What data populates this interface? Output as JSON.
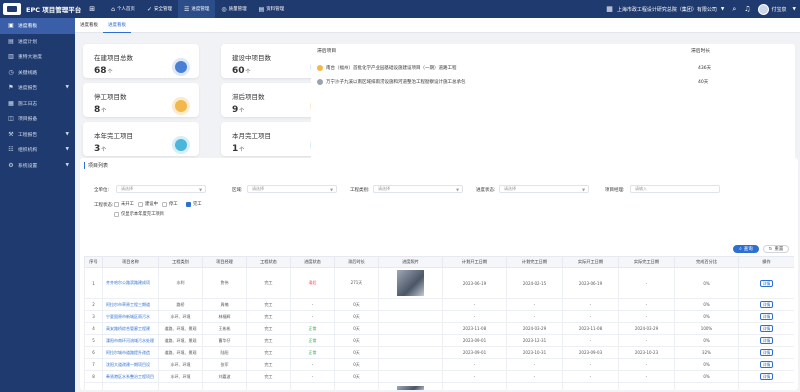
{
  "app": {
    "title": "EPC 项目管理平台"
  },
  "topnav": [
    {
      "icon": "⌂",
      "label": "个人首页",
      "active": false
    },
    {
      "icon": "✓",
      "label": "安全管理",
      "active": false
    },
    {
      "icon": "☰",
      "label": "进度管理",
      "active": true
    },
    {
      "icon": "◎",
      "label": "质量管理",
      "active": false
    },
    {
      "icon": "▤",
      "label": "资料管理",
      "active": false
    }
  ],
  "header": {
    "company": "上海市政工程设计研究总院（集团）有限公司",
    "user": "付宝泉"
  },
  "sidebar": [
    {
      "icon": "▣",
      "label": "进度看板",
      "active": true,
      "expandable": false
    },
    {
      "icon": "▤",
      "label": "进度计划",
      "active": false,
      "expandable": false
    },
    {
      "icon": "▥",
      "label": "重特大进度",
      "active": false,
      "expandable": false
    },
    {
      "icon": "◷",
      "label": "关键线路",
      "active": false,
      "expandable": false
    },
    {
      "icon": "⚑",
      "label": "进度报告",
      "active": false,
      "expandable": true
    },
    {
      "icon": "▦",
      "label": "施工日志",
      "active": false,
      "expandable": false
    },
    {
      "icon": "◫",
      "label": "项目报备",
      "active": false,
      "expandable": false
    },
    {
      "icon": "⚒",
      "label": "工程报告",
      "active": false,
      "expandable": true
    },
    {
      "icon": "☷",
      "label": "组织机构",
      "active": false,
      "expandable": true
    },
    {
      "icon": "⚙",
      "label": "系统设置",
      "active": false,
      "expandable": true
    }
  ],
  "tabs": [
    {
      "label": "进度看板",
      "active": false
    },
    {
      "label": "进度看板",
      "active": true
    }
  ],
  "stats": [
    {
      "title": "在建项目总数",
      "value": "68",
      "unit": "个",
      "color": "#4a7fd6",
      "bg": "#dde8fa"
    },
    {
      "title": "建设中项目数",
      "value": "60",
      "unit": "个",
      "color": "#4a7fd6",
      "bg": "#dde8fa"
    },
    {
      "title": "停工项目数",
      "value": "8",
      "unit": "个",
      "color": "#f2b84b",
      "bg": "#fbeacb"
    },
    {
      "title": "滞后项目数",
      "value": "9",
      "unit": "个",
      "color": "#f2b84b",
      "bg": "#fbeacb"
    },
    {
      "title": "本年完工项目",
      "value": "3",
      "unit": "个",
      "color": "#4ab6d9",
      "bg": "#d6eef7"
    },
    {
      "title": "本月完工项目",
      "value": "1",
      "unit": "个",
      "color": "#4ab6d9",
      "bg": "#d6eef7"
    }
  ],
  "delay": {
    "col_project": "滞后项目",
    "col_duration": "滞后时长",
    "rows": [
      {
        "name": "南台（福州）首批化学产业园基础设施建设项目（一期）道路工程",
        "duration": "436天",
        "color": "#f2b84b"
      },
      {
        "name": "万宁沙子九溪以南区域排雨涝设施和河道整治工程勘察设计施工总承包",
        "duration": "40天",
        "color": "#9aa4b1"
      }
    ]
  },
  "list": {
    "title": "项目列表",
    "filters": {
      "company_label": "全单位:",
      "company_ph": "请选择",
      "region_label": "区域:",
      "region_ph": "请选择",
      "type_label": "工程类别:",
      "type_ph": "请选择",
      "progress_label": "进度状态:",
      "progress_ph": "请选择",
      "manager_label": "项目经理:",
      "manager_ph": "请输入"
    },
    "status_label": "工程状态:",
    "statuses": [
      {
        "label": "未开工",
        "checked": false
      },
      {
        "label": "建设中",
        "checked": false
      },
      {
        "label": "停工",
        "checked": false
      },
      {
        "label": "完工",
        "checked": true
      }
    ],
    "year_only": "仅显示本年度完工项目",
    "search_btn": "查询",
    "reset_btn": "重置",
    "columns": [
      "序号",
      "项目名称",
      "工程类别",
      "项目经理",
      "工程状态",
      "进度状态",
      "滞后时长",
      "进度照片",
      "计划开工日期",
      "计划完工日期",
      "实际开工日期",
      "实际完工日期",
      "完成百分比",
      "操作"
    ],
    "rows": [
      {
        "no": "1",
        "name": "齐齐哈尔公路滨路建成项",
        "type": "水利",
        "manager": "詹伟",
        "status": "完工",
        "progress": "滞后",
        "delay": "271天",
        "photo": true,
        "plan_start": "2023-06-19",
        "plan_end": "2024-02-15",
        "act_start": "2023-06-19",
        "act_end": "-",
        "pct": "0%",
        "op": "详情",
        "tall": true
      },
      {
        "no": "2",
        "name": "阿拉尔市草原工程三期道",
        "type": "路桥",
        "manager": "周楠",
        "status": "完工",
        "progress": "-",
        "delay": "0天",
        "photo": false,
        "plan_start": "-",
        "plan_end": "-",
        "act_start": "-",
        "act_end": "-",
        "pct": "0%",
        "op": "详情",
        "tall": false
      },
      {
        "no": "3",
        "name": "宁夏固原市新城区雨污水",
        "type": "水环、环境",
        "manager": "林福辉",
        "status": "完工",
        "progress": "-",
        "delay": "0天",
        "photo": false,
        "plan_start": "-",
        "plan_end": "-",
        "act_start": "-",
        "act_end": "-",
        "pct": "0%",
        "op": "详情",
        "tall": false
      },
      {
        "no": "4",
        "name": "高安路桥综合管廊工程建",
        "type": "道路、环境、景观",
        "manager": "王彬彬",
        "status": "完工",
        "progress": "正常",
        "delay": "0天",
        "photo": false,
        "plan_start": "2023-11-08",
        "plan_end": "2024-03-29",
        "act_start": "2023-11-08",
        "act_end": "2024-03-29",
        "pct": "100%",
        "op": "详情",
        "tall": false
      },
      {
        "no": "5",
        "name": "溧阳市南环河流域污水处理",
        "type": "道路、环境、景观",
        "manager": "曹华仔",
        "status": "完工",
        "progress": "正常",
        "delay": "0天",
        "photo": false,
        "plan_start": "2023-09-01",
        "plan_end": "2023-12-31",
        "act_start": "-",
        "act_end": "-",
        "pct": "0%",
        "op": "详情",
        "tall": false
      },
      {
        "no": "6",
        "name": "阿拉尔城市道路提升改造",
        "type": "道路、环境、景观",
        "manager": "陆阳",
        "status": "完工",
        "progress": "正常",
        "delay": "0天",
        "photo": false,
        "plan_start": "2023-09-01",
        "plan_end": "2023-10-31",
        "act_start": "2023-09-03",
        "act_end": "2023-10-23",
        "pct": "32%",
        "op": "详情",
        "tall": false
      },
      {
        "no": "7",
        "name": "沈阳大道改建一期项目设",
        "type": "水环、环境",
        "manager": "张军",
        "status": "完工",
        "progress": "-",
        "delay": "0天",
        "photo": false,
        "plan_start": "-",
        "plan_end": "-",
        "act_start": "-",
        "act_end": "-",
        "pct": "0%",
        "op": "详情",
        "tall": false
      },
      {
        "no": "8",
        "name": "奉贤港区水系整治工程项目",
        "type": "水环、环境",
        "manager": "刘嘉波",
        "status": "完工",
        "progress": "-",
        "delay": "0天",
        "photo": false,
        "plan_start": "-",
        "plan_end": "-",
        "act_start": "-",
        "act_end": "-",
        "pct": "0%",
        "op": "详情",
        "tall": false
      },
      {
        "no": "",
        "name": "",
        "type": "",
        "manager": "",
        "status": "",
        "progress": "",
        "delay": "",
        "photo": true,
        "plan_start": "",
        "plan_end": "",
        "act_start": "",
        "act_end": "",
        "pct": "",
        "op": "",
        "tall": false,
        "partial": true
      }
    ]
  }
}
